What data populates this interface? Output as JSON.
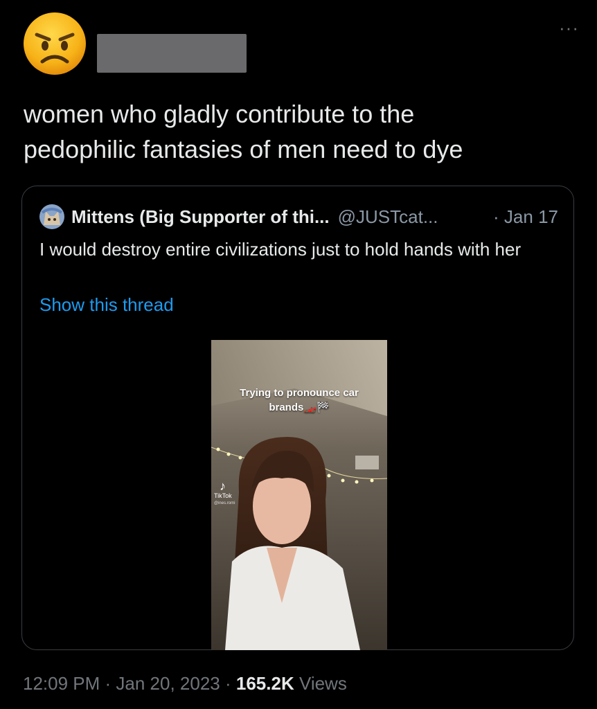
{
  "tweet": {
    "author_emoji": "angry-face",
    "more_label": "···",
    "text": "women who gladly contribute to the\npedophilic fantasies of men need to dye"
  },
  "quote": {
    "name": "Mittens (Big Supporter of thi...",
    "handle": "@JUSTcat...",
    "date": "· Jan 17",
    "text": "I would destroy entire civilizations just to hold hands with her",
    "show_thread": "Show this thread",
    "video": {
      "caption_line1": "Trying to pronounce car",
      "caption_line2": "brands🏎️🏁",
      "tiktok_label": "TikTok",
      "tiktok_handle": "@ines.romi"
    }
  },
  "footer": {
    "time": "12:09 PM",
    "sep1": " · ",
    "date": "Jan 20, 2023",
    "sep2": " · ",
    "views_count": "165.2K",
    "views_label": " Views"
  },
  "colors": {
    "background": "#000000",
    "text": "#e7e9ea",
    "secondary": "#71767b",
    "link": "#1d9bf0",
    "border": "#3a3e43"
  }
}
